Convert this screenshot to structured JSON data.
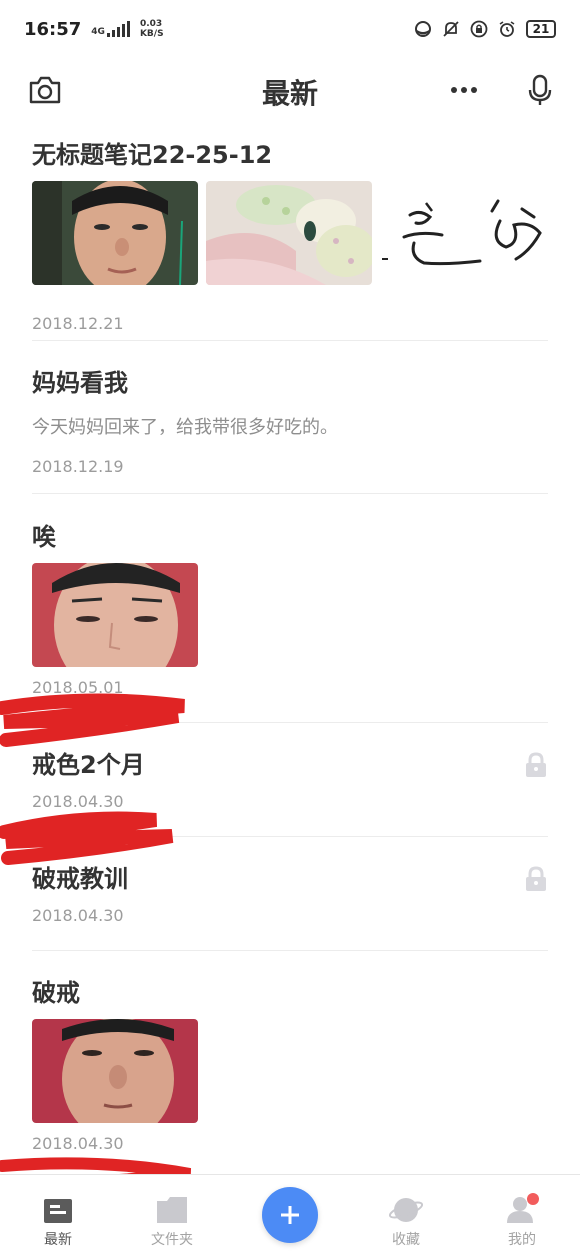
{
  "status_bar": {
    "time": "16:57",
    "network": "4G",
    "speed_value": "0.03",
    "speed_unit": "KB/S",
    "battery": "21"
  },
  "header": {
    "title": "最新",
    "camera_icon": "camera-icon",
    "more_icon": "more-icon",
    "mic_icon": "microphone-icon"
  },
  "notes": [
    {
      "title": "无标题笔记22-25-12",
      "date": "2018.12.21",
      "signature_text": "-是 皓"
    },
    {
      "title": "妈妈看我",
      "excerpt": "今天妈妈回来了，给我带很多好吃的。",
      "date": "2018.12.19"
    },
    {
      "title": "唉",
      "date": "2018.05.01"
    },
    {
      "title": "戒色2个月",
      "date": "2018.04.30",
      "locked": true
    },
    {
      "title": "破戒教训",
      "date": "2018.04.30",
      "locked": true
    },
    {
      "title": "破戒",
      "date": "2018.04.30"
    }
  ],
  "bottom_nav": {
    "items": [
      {
        "label": "最新",
        "icon": "note-icon"
      },
      {
        "label": "文件夹",
        "icon": "folder-icon"
      },
      {
        "label": "收藏",
        "icon": "planet-icon"
      },
      {
        "label": "我的",
        "icon": "person-icon"
      }
    ],
    "fab_icon": "plus-icon"
  },
  "colors": {
    "accent": "#4c8bf5",
    "scribble": "#e02424"
  }
}
